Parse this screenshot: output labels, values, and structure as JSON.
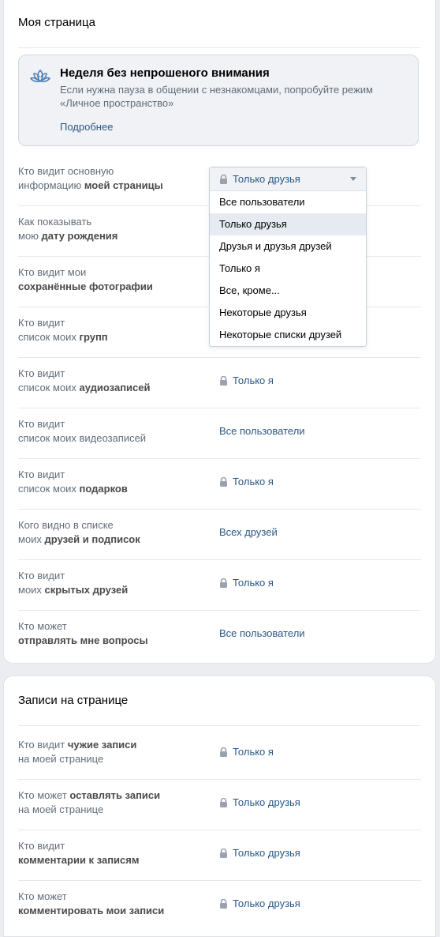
{
  "section1": {
    "title": "Моя страница",
    "promo": {
      "title": "Неделя без непрошеного внимания",
      "text": "Если нужна пауза в общении с незнакомцами, попробуйте режим «Личное пространство»",
      "link": "Подробнее",
      "icon": "lotus-icon"
    },
    "rows": [
      {
        "l1": "Кто видит основную",
        "l2a": "информацию ",
        "l2b": "моей страницы",
        "value": "Только друзья",
        "locked": true
      },
      {
        "l1": "Как показывать",
        "l2a": "мою ",
        "l2b": "дату рождения",
        "value": "",
        "locked": false
      },
      {
        "l1": "Кто видит мои",
        "l2a": "",
        "l2b": "сохранённые фотографии",
        "value": "",
        "locked": false
      },
      {
        "l1": "Кто видит",
        "l2a": "список моих ",
        "l2b": "групп",
        "value": "",
        "locked": false
      },
      {
        "l1": "Кто видит",
        "l2a": "список моих ",
        "l2b": "аудиозаписей",
        "value": "Только я",
        "locked": true
      },
      {
        "l1": "Кто видит",
        "l2a": "список моих видеозаписей",
        "l2b": "",
        "value": "Все пользователи",
        "locked": false
      },
      {
        "l1": "Кто видит",
        "l2a": "список моих ",
        "l2b": "подарков",
        "value": "Только я",
        "locked": true
      },
      {
        "l1": "Кого видно в списке",
        "l2a": "моих ",
        "l2b": "друзей и подписок",
        "value": "Всех друзей",
        "locked": false
      },
      {
        "l1": "Кто видит",
        "l2a": "моих ",
        "l2b": "скрытых друзей",
        "value": "Только я",
        "locked": true
      },
      {
        "l1": "Кто может",
        "l2a": "",
        "l2b": "отправлять мне вопросы",
        "value": "Все пользователи",
        "locked": false
      }
    ]
  },
  "dropdown": {
    "selected": "Только друзья",
    "options": [
      "Все пользователи",
      "Только друзья",
      "Друзья и друзья друзей",
      "Только я",
      "Все, кроме...",
      "Некоторые друзья",
      "Некоторые списки друзей"
    ],
    "highlighted_index": 1
  },
  "section2": {
    "title": "Записи на странице",
    "rows": [
      {
        "l1a": "Кто видит ",
        "l1b": "чужие записи",
        "l2a": "на моей странице",
        "l2b": "",
        "value": "Только я",
        "locked": true
      },
      {
        "l1a": "Кто может ",
        "l1b": "оставлять записи",
        "l2a": "на моей странице",
        "l2b": "",
        "value": "Только друзья",
        "locked": true
      },
      {
        "l1a": "Кто видит",
        "l1b": "",
        "l2a": "",
        "l2b": "комментарии к записям",
        "value": "Только друзья",
        "locked": true
      },
      {
        "l1a": "Кто может",
        "l1b": "",
        "l2a": "",
        "l2b": "комментировать мои записи",
        "value": "Только друзья",
        "locked": true
      }
    ]
  },
  "colors": {
    "link": "#2a5885",
    "label": "#626d7a",
    "background": "#ebedf0"
  }
}
